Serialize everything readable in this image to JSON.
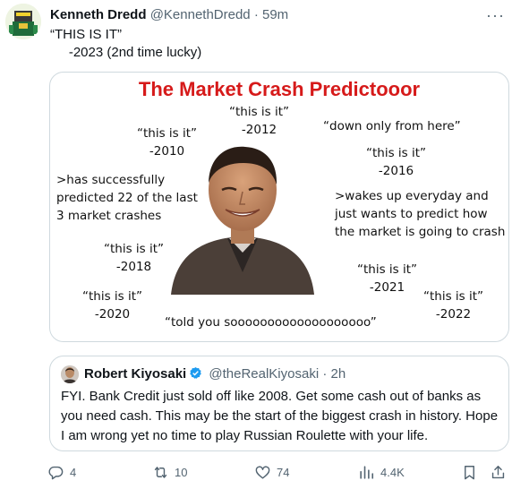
{
  "tweet": {
    "author_name": "Kenneth Dredd",
    "handle": "@KennethDredd",
    "separator": "·",
    "time": "59m",
    "text_line1": "“THIS IS IT”",
    "text_line2": "     -2023 (2nd time lucky)",
    "more_icon": "more-horizontal-icon"
  },
  "meme": {
    "title": "The Market Crash Predictooor",
    "labels": {
      "y2012": "“this is it”\n-2012",
      "y2010": "“this is it”\n-2010",
      "down_only": "“down only from here”",
      "y2016": "“this is it”\n-2016",
      "predicted": ">has successfully\npredicted 22 of the last\n3 market crashes",
      "wakes_up": ">wakes up everyday and\njust wants to predict how\nthe market is going to crash",
      "y2018": "“this is it”\n-2018",
      "y2021": "“this is it”\n-2021",
      "y2020": "“this is it”\n-2020",
      "y2022": "“this is it”\n-2022",
      "told_you": "“told you sooooooooooooooooooo”"
    }
  },
  "quoted": {
    "author_name": "Robert Kiyosaki",
    "handle": "@theRealKiyosaki",
    "separator": "·",
    "time": "2h",
    "text": "FYI. Bank Credit just sold off like 2008. Get some cash out of banks as you need cash. This may be the start of the biggest crash in history. Hope I am wrong yet no time to play Russian Roulette with your life."
  },
  "actions": {
    "replies": "4",
    "retweets": "10",
    "likes": "74",
    "views": "4.4K"
  },
  "colors": {
    "title_red": "#d61a1a",
    "verified_blue": "#1d9bf0",
    "muted": "#536471",
    "border": "#cfd9de"
  }
}
